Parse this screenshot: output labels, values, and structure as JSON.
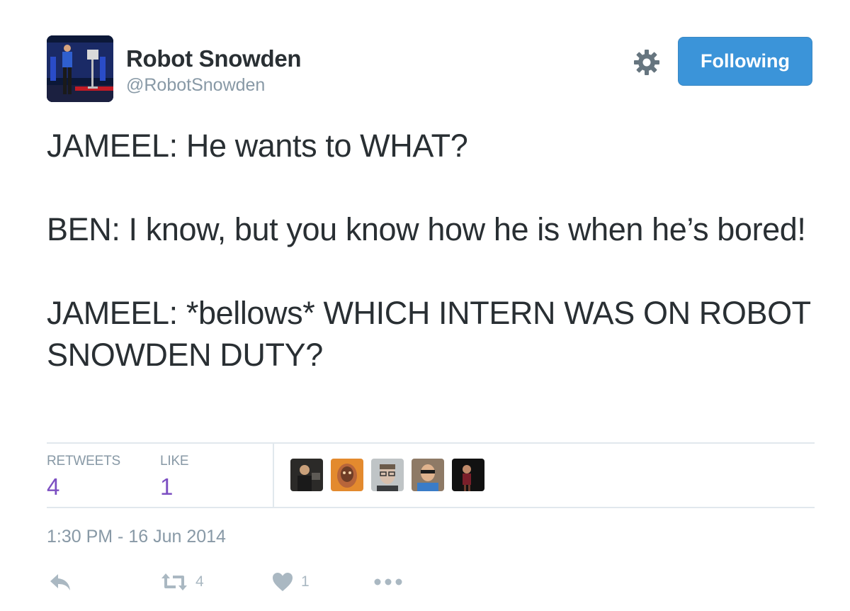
{
  "user": {
    "display_name": "Robot Snowden",
    "handle": "@RobotSnowden",
    "avatar_icon": "avatar-photo"
  },
  "header": {
    "settings_icon": "gear-icon",
    "follow_label": "Following"
  },
  "tweet": {
    "lines": [
      "JAMEEL: He wants to WHAT?",
      "BEN: I know, but you know how he is when he’s bored!",
      "JAMEEL: *bellows* WHICH INTERN WAS ON ROBOT SNOWDEN DUTY?"
    ]
  },
  "stats": {
    "retweets_label": "RETWEETS",
    "retweets_count": "4",
    "likes_label": "LIKE",
    "likes_count": "1",
    "liker_avatars": [
      "liker-avatar-1",
      "liker-avatar-2",
      "liker-avatar-3",
      "liker-avatar-4",
      "liker-avatar-5"
    ]
  },
  "timestamp": "1:30 PM - 16 Jun 2014",
  "actions": {
    "reply_icon": "reply-icon",
    "retweet_icon": "retweet-icon",
    "retweet_count": "4",
    "like_icon": "heart-icon",
    "like_count": "1",
    "more_icon": "more-icon"
  },
  "colors": {
    "follow_button": "#3b94d9",
    "stat_value": "#7c4fc2",
    "muted_text": "#8899a6",
    "action_icon": "#aab8c2",
    "divider": "#e1e8ed"
  }
}
